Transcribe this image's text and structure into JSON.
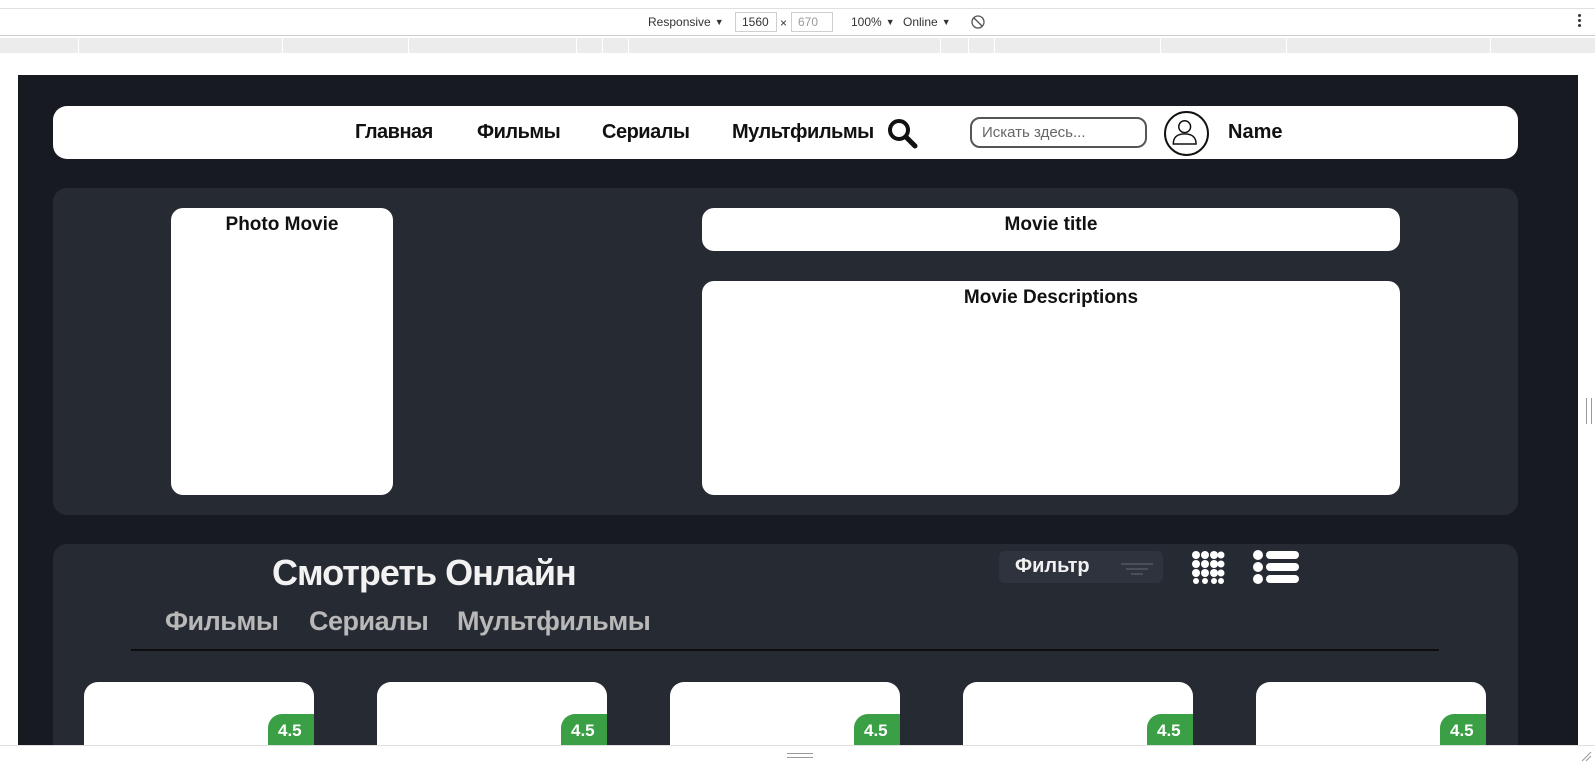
{
  "devtools": {
    "device": "Responsive",
    "width": "1560",
    "height": "670",
    "times": "×",
    "zoom": "100%",
    "network": "Online",
    "caret": "▼"
  },
  "nav": {
    "links": [
      "Главная",
      "Фильмы",
      "Сериалы",
      "Мультфильмы"
    ],
    "search_placeholder": "Искать здесь...",
    "user_name": "Name"
  },
  "movie": {
    "photo_label": "Photo Movie",
    "title_label": "Movie title",
    "description_label": "Movie Descriptions"
  },
  "watch": {
    "title": "Смотреть Онлайн",
    "filter_label": "Фильтр",
    "tabs": [
      "Фильмы",
      "Сериалы",
      "Мультфильмы"
    ]
  },
  "cards": [
    {
      "rating": "4.5"
    },
    {
      "rating": "4.5"
    },
    {
      "rating": "4.5"
    },
    {
      "rating": "4.5"
    },
    {
      "rating": "4.5"
    }
  ],
  "colors": {
    "page_bg": "#171a21",
    "panel_bg": "#262a33",
    "rating_green": "#3a9f45"
  }
}
